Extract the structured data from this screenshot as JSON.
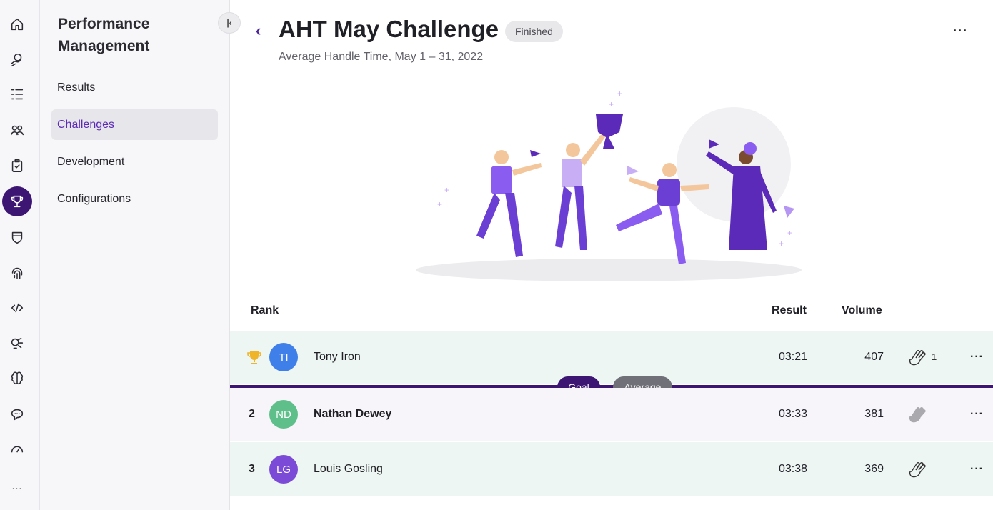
{
  "sidebar": {
    "title": "Performance Management",
    "items": [
      {
        "label": "Results"
      },
      {
        "label": "Challenges"
      },
      {
        "label": "Development"
      },
      {
        "label": "Configurations"
      }
    ],
    "collapse_icon": "collapse-left-icon"
  },
  "rail": {
    "icons": [
      "home-icon",
      "hand-coins-icon",
      "checklist-icon",
      "team-icon",
      "clipboard-check-icon",
      "trophy-icon",
      "shield-icon",
      "fingerprint-icon",
      "code-icon",
      "robot-icon",
      "brain-icon",
      "chat-icon",
      "speedometer-icon"
    ],
    "more": "..."
  },
  "header": {
    "back_icon": "chevron-left-icon",
    "title": "AHT May Challenge",
    "status": "Finished",
    "subtitle": "Average Handle Time, May 1 – 31, 2022",
    "more": "···"
  },
  "table": {
    "columns": {
      "rank": "Rank",
      "result": "Result",
      "volume": "Volume"
    },
    "rows": [
      {
        "rank": "",
        "icon": "trophy-icon",
        "initials": "TI",
        "name": "Tony Iron",
        "result": "03:21",
        "volume": "407",
        "claps": "1",
        "avatar_color": "#3f7fea"
      },
      {
        "rank": "2",
        "initials": "ND",
        "name": "Nathan Dewey",
        "result": "03:33",
        "volume": "381",
        "claps": "",
        "avatar_color": "#5fbf8a"
      },
      {
        "rank": "3",
        "initials": "LG",
        "name": "Louis Gosling",
        "result": "03:38",
        "volume": "369",
        "claps": "",
        "avatar_color": "#7b4ad6"
      }
    ],
    "markers": {
      "goal": "Goal",
      "average": "Average"
    },
    "row_more": "···"
  },
  "colors": {
    "accent": "#3d1673",
    "row_green": "#edf6f2",
    "row_purple": "#f7f5fa"
  }
}
